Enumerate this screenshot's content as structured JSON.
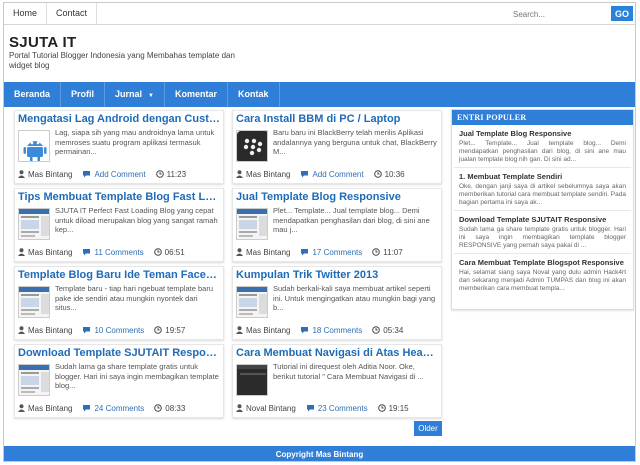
{
  "topnav": {
    "home": "Home",
    "contact": "Contact"
  },
  "search": {
    "placeholder": "Search...",
    "button": "GO"
  },
  "site": {
    "title": "SJUTA IT",
    "description": "Portal Tutorial Blogger Indonesia yang Membahas template dan widget blog"
  },
  "mainnav": [
    "Beranda",
    "Profil",
    "Jurnal",
    "Komentar",
    "Kontak"
  ],
  "posts": [
    {
      "title": "Mengatasi Lag Android dengan Custo...",
      "excerpt": "Lag, siapa sih yang mau androidnya lama untuk memroses suatu program aplikasi termasuk permainan...",
      "author": "Mas Bintang",
      "comments": "Add Comment",
      "time": "11:23",
      "thumb": "android-robot"
    },
    {
      "title": "Cara Install BBM di PC / Laptop",
      "excerpt": "Baru baru ini BlackBerry telah merilis Aplikasi andalannya yang berguna untuk chat, BlackBerry M...",
      "author": "Mas Bintang",
      "comments": "Add Comment",
      "time": "10:36",
      "thumb": "blackberry"
    },
    {
      "title": "Tips Membuat Template Blog Fast Lo...",
      "excerpt": "SJUTA IT Perfect Fast Loading Blog yang cepat untuk diload merupakan blog yang sangat ramah kep...",
      "author": "Mas Bintang",
      "comments": "11 Comments",
      "time": "06:51",
      "thumb": "template"
    },
    {
      "title": "Jual Template Blog Responsive",
      "excerpt": "Plet... Template... Jual template blog... Demi mendapatkan penghasilan dari blog, di sini ane mau j...",
      "author": "Mas Bintang",
      "comments": "17 Comments",
      "time": "11:07",
      "thumb": "template"
    },
    {
      "title": "Template Blog Baru Ide Teman Faceb...",
      "excerpt": "Template baru - tiap hari ngebuat template baru pake ide sendiri atau mungkin nyontek dari situs...",
      "author": "Mas Bintang",
      "comments": "10 Comments",
      "time": "19:57",
      "thumb": "template"
    },
    {
      "title": "Kumpulan Trik Twitter 2013",
      "excerpt": "Sudah berkali-kali saya membuat artikel seperti ini. Untuk mengingatkan atau mungkin bagi yang b...",
      "author": "Mas Bintang",
      "comments": "18 Comments",
      "time": "05:34",
      "thumb": "template"
    },
    {
      "title": "Download Template SJUTAIT Respon...",
      "excerpt": "Sudah lama ga share template gratis untuk blogger. Hari ini saya ingin membagikan template blog...",
      "author": "Mas Bintang",
      "comments": "24 Comments",
      "time": "08:33",
      "thumb": "template"
    },
    {
      "title": "Cara Membuat Navigasi di Atas Header",
      "excerpt": "Tutorial ini direquest oleh Aditia Noor. Oke, berikut tutorial \" Cara Membuat Navigasi di ...",
      "author": "Noval Bintang",
      "comments": "23 Comments",
      "time": "19:15",
      "thumb": "dark"
    }
  ],
  "sidebar": {
    "heading": "ENTRI POPULER",
    "items": [
      {
        "title": "Jual Template Blog Responsive",
        "excerpt": "Plet... Template... Jual template blog... Demi mendapatkan penghasilan dari blog, di sini ane mau jualan template blog nih gan. Di sini ad..."
      },
      {
        "title": "1. Membuat Template Sendiri",
        "excerpt": "Oke, dengan janji saya di artikel sebelumnya saya akan memberikan tutorial cara membuat template sendiri. Pada bagian pertama ini saya ak..."
      },
      {
        "title": "Download Template SJUTAIT Responsive",
        "excerpt": "Sudah lama ga share template gratis untuk blogger. Hari ini saya ingin membagikan template blogger RESPONSIVE yang pernah saya pakai di ..."
      },
      {
        "title": "Cara Membuat Template Blogspot Responsive",
        "excerpt": "Hai, selamat siang saya Noval yang dulu admin Hack4rt dan sekarang menjadi Admin TUMPAS dan blog ini akan memberikan cara membuat templa..."
      }
    ]
  },
  "older": "Older",
  "footer": "Copyright Mas Bintang"
}
